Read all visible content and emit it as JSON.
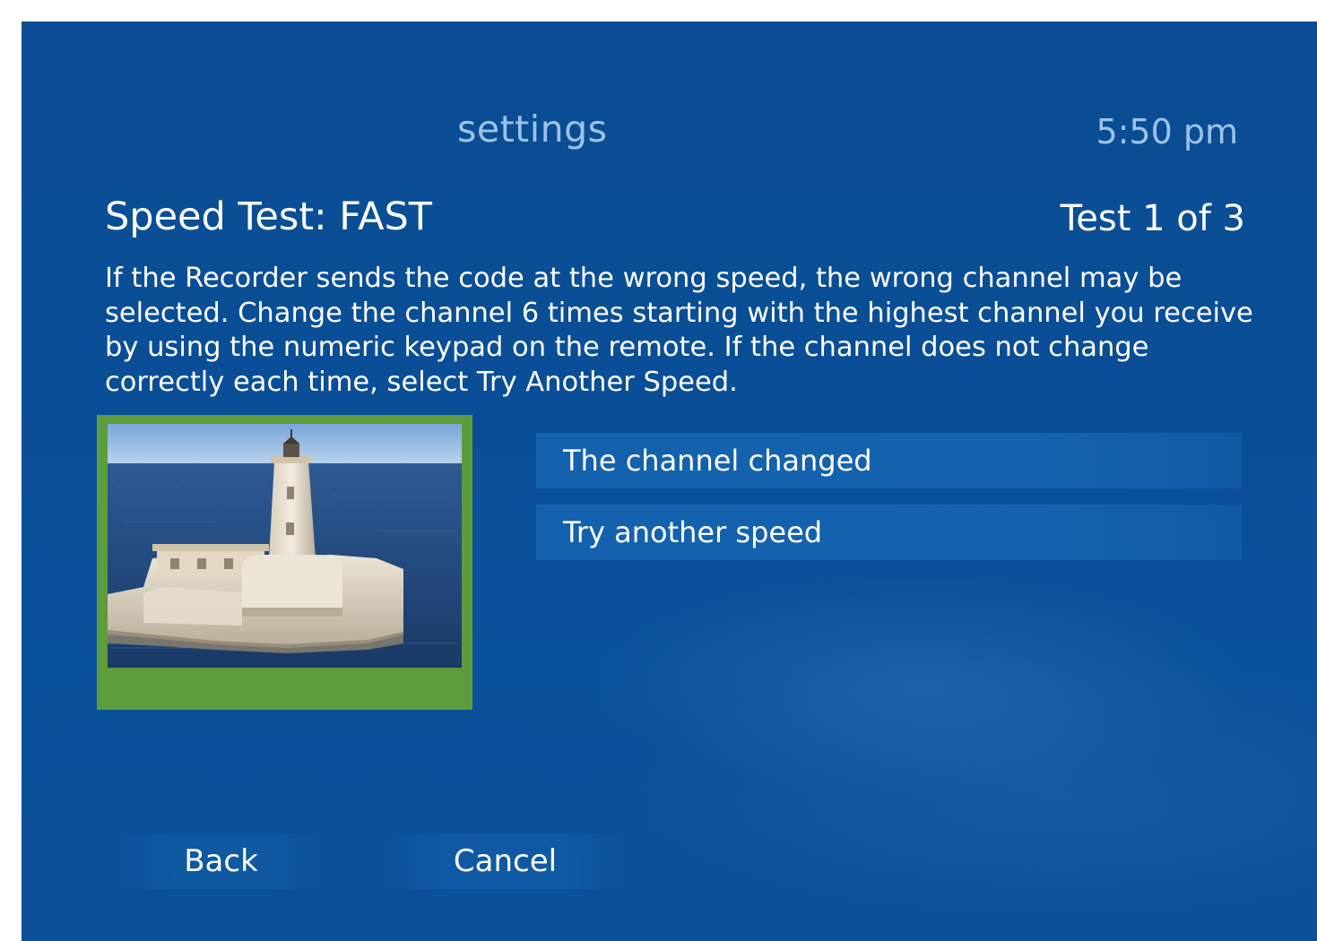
{
  "header": {
    "title": "settings",
    "time": "5:50 pm"
  },
  "page": {
    "heading": "Speed Test: FAST",
    "counter": "Test 1 of 3",
    "instructions": "If the Recorder sends the code at the wrong speed, the wrong channel may be selected. Change the channel 6 times starting with the highest channel you receive by using the numeric keypad on the remote. If the channel does not change correctly each time, select Try Another Speed."
  },
  "options": [
    {
      "label": "The channel changed"
    },
    {
      "label": "Try another speed"
    }
  ],
  "nav": {
    "back_label": "Back",
    "cancel_label": "Cancel"
  },
  "preview": {
    "icon": "lighthouse-photo",
    "frame_color": "#5d9c3c"
  },
  "colors": {
    "background": "#0a4e97",
    "title_text": "#9cc4e6",
    "option_bg": "#1563ae"
  }
}
